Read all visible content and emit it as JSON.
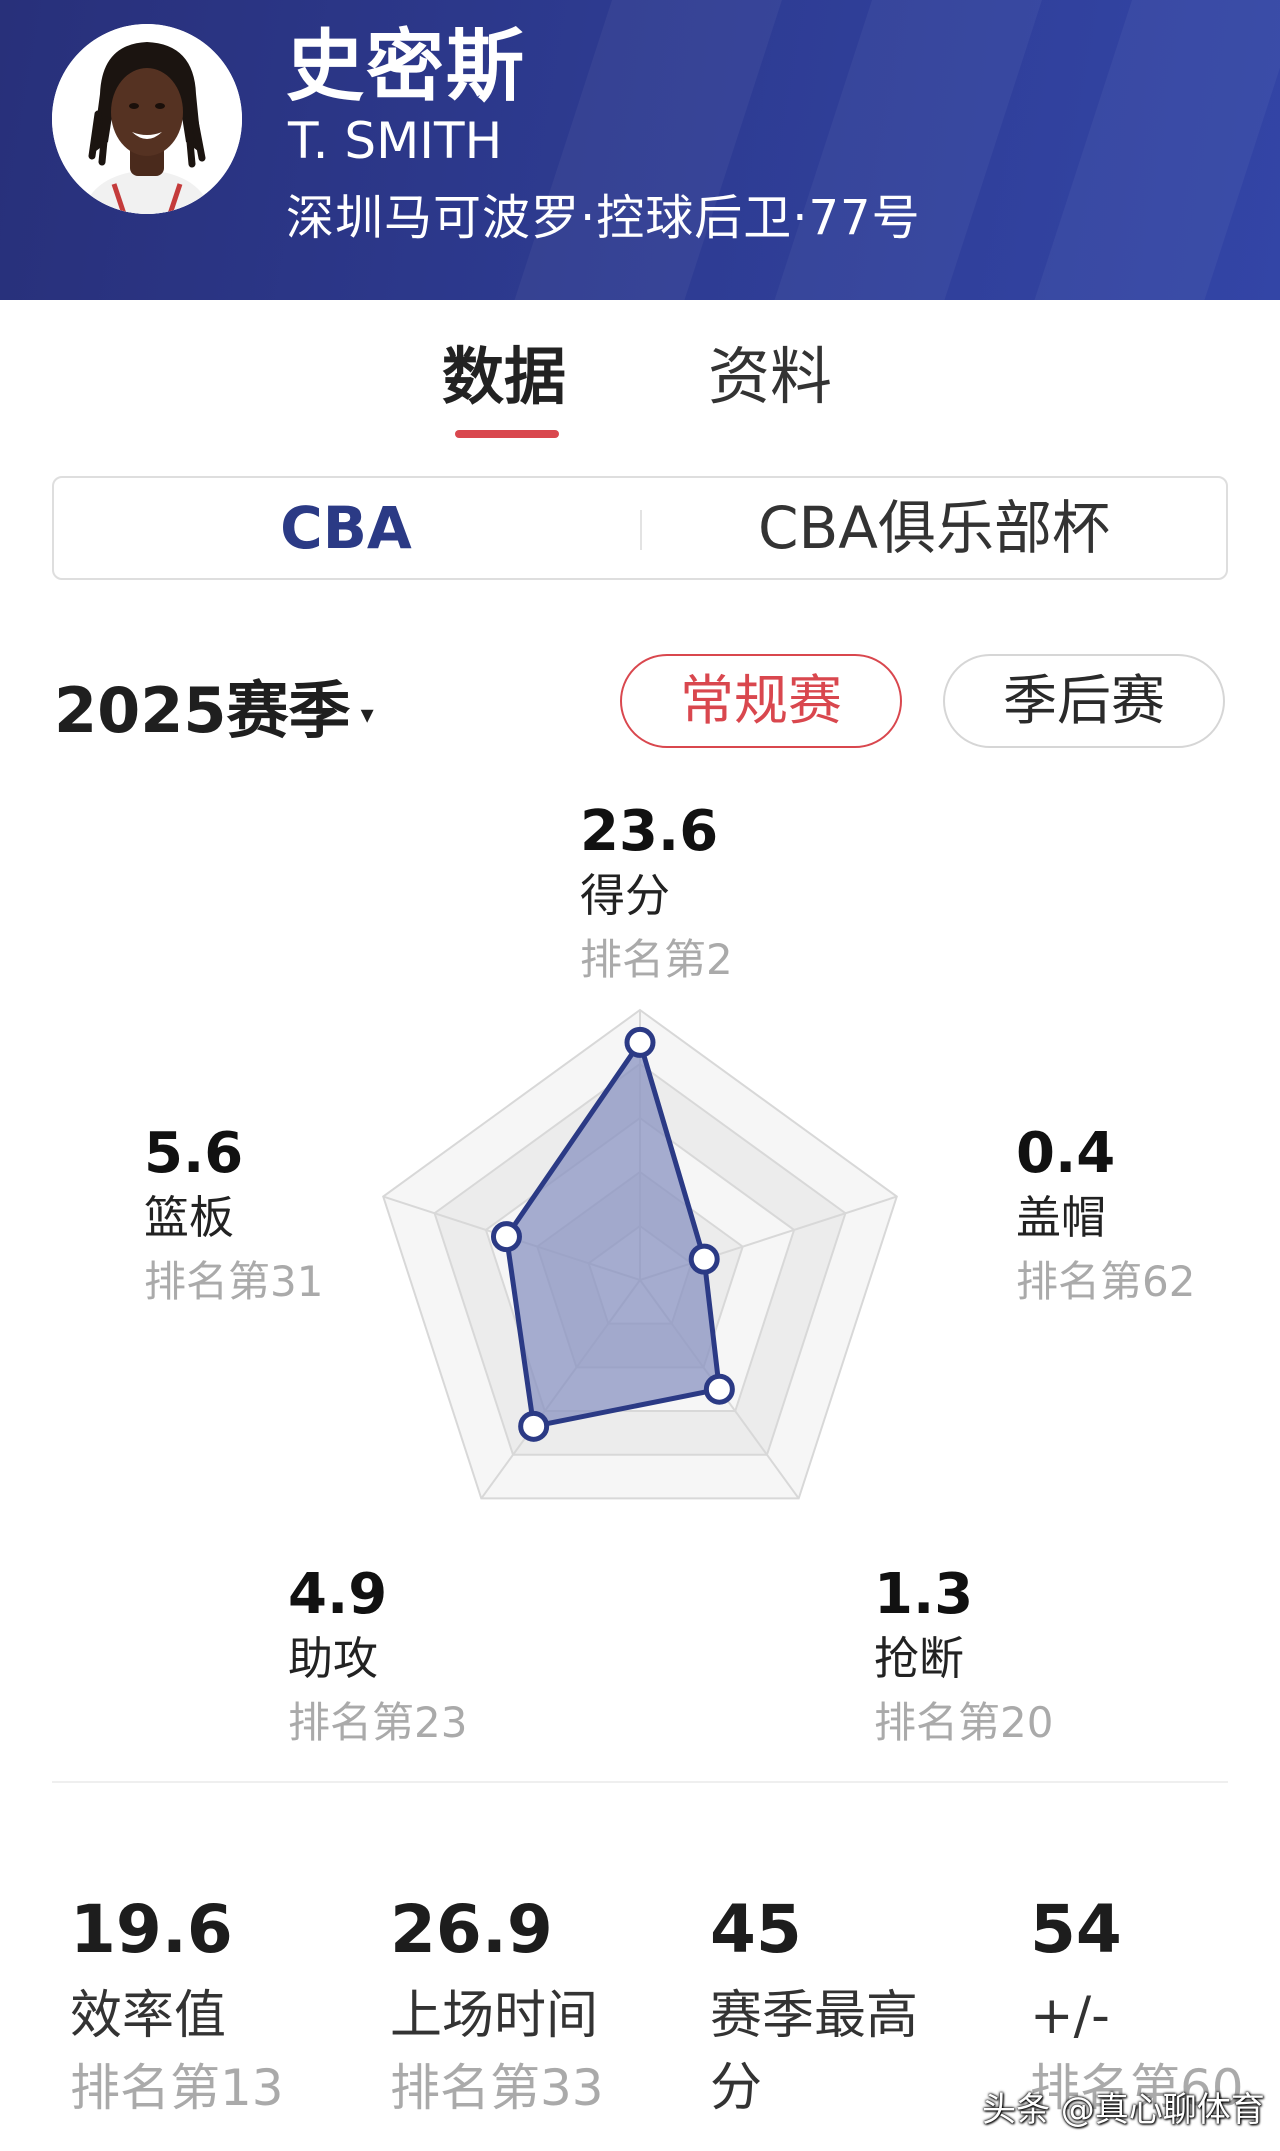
{
  "player": {
    "name_cn": "史密斯",
    "name_en": "T. SMITH",
    "team_info": "深圳马可波罗·控球后卫·77号"
  },
  "tabs": [
    {
      "label": "数据",
      "active": true
    },
    {
      "label": "资料",
      "active": false
    }
  ],
  "league_switch": [
    {
      "label": "CBA",
      "active": true
    },
    {
      "label": "CBA俱乐部杯",
      "active": false
    }
  ],
  "season": {
    "label": "2025赛季",
    "caret": "▾"
  },
  "game_type": [
    {
      "label": "常规赛",
      "active": true
    },
    {
      "label": "季后赛",
      "active": false
    }
  ],
  "chart_data": {
    "type": "radar",
    "axes": [
      "得分",
      "盖帽",
      "抢断",
      "助攻",
      "篮板"
    ],
    "normalized_levels": [
      0.88,
      0.25,
      0.5,
      0.67,
      0.52
    ],
    "stats": [
      {
        "label": "得分",
        "value": "23.6",
        "rank": "排名第2"
      },
      {
        "label": "盖帽",
        "value": "0.4",
        "rank": "排名第62"
      },
      {
        "label": "抢断",
        "value": "1.3",
        "rank": "排名第20"
      },
      {
        "label": "助攻",
        "value": "4.9",
        "rank": "排名第23"
      },
      {
        "label": "篮板",
        "value": "5.6",
        "rank": "排名第31"
      }
    ],
    "grid_rings": 5,
    "fill_color": "#8a93c2",
    "line_color": "#2b3a85"
  },
  "summary_stats": [
    {
      "value": "19.6",
      "label": "效率值",
      "rank": "排名第13"
    },
    {
      "value": "26.9",
      "label": "上场时间",
      "rank": "排名第33"
    },
    {
      "value": "45",
      "label": "赛季最高分",
      "rank": ""
    },
    {
      "value": "54",
      "label": "+/-",
      "rank": "排名第60"
    }
  ],
  "watermark": "头条 @真心聊体育",
  "colors": {
    "header_bg": "#2d3a8f",
    "accent_red": "#d9474e",
    "accent_blue": "#2b3a85"
  }
}
